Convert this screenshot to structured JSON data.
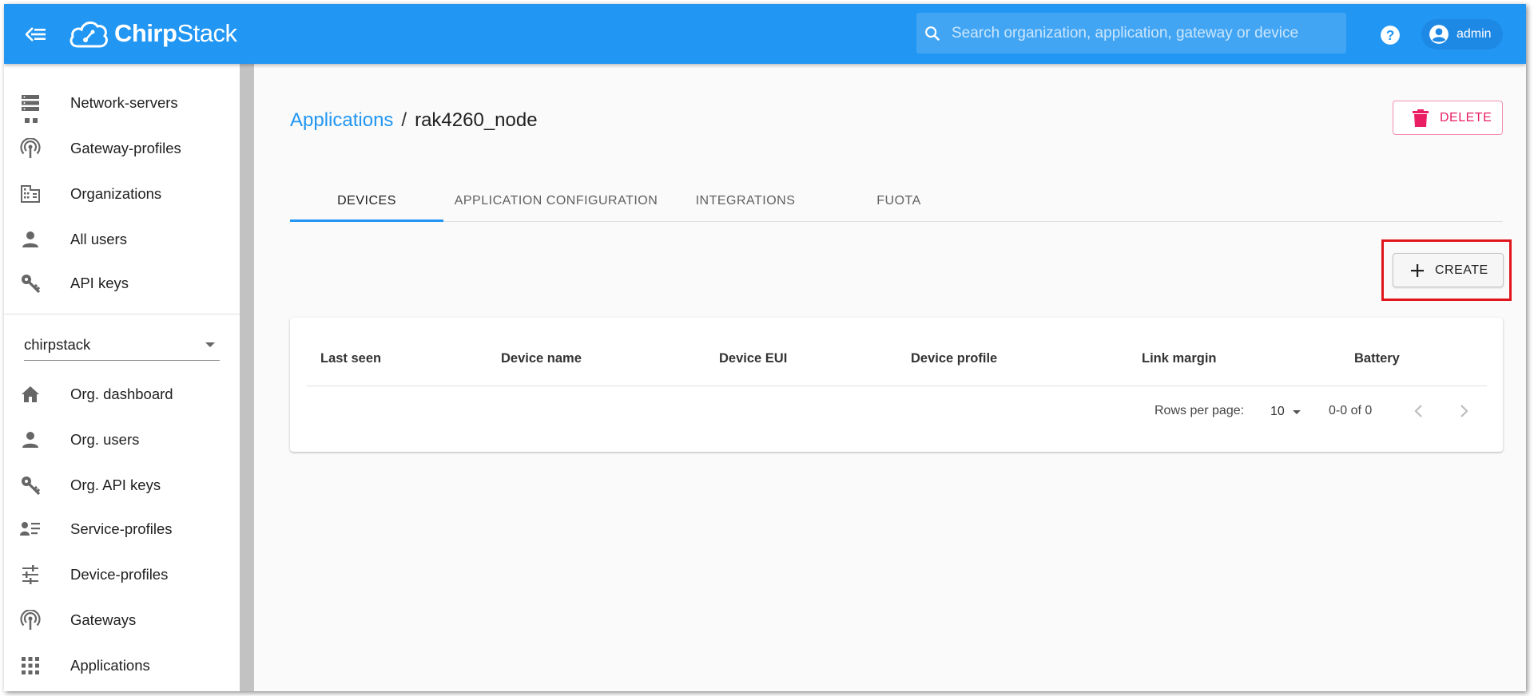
{
  "appbar": {
    "brand_prefix": "Chirp",
    "brand_suffix": "Stack",
    "search_placeholder": "Search organization, application, gateway or device",
    "user_name": "admin",
    "color": "#2196f3"
  },
  "sidebar": {
    "global_items": [
      {
        "label": "Network-servers",
        "icon": "network-server-icon"
      },
      {
        "label": "Gateway-profiles",
        "icon": "gateway-icon"
      },
      {
        "label": "Organizations",
        "icon": "organization-icon"
      },
      {
        "label": "All users",
        "icon": "user-icon"
      },
      {
        "label": "API keys",
        "icon": "key-icon"
      }
    ],
    "org_selected": "chirpstack",
    "org_items": [
      {
        "label": "Org. dashboard",
        "icon": "home-icon"
      },
      {
        "label": "Org. users",
        "icon": "user-icon"
      },
      {
        "label": "Org. API keys",
        "icon": "key-icon"
      },
      {
        "label": "Service-profiles",
        "icon": "service-profile-icon"
      },
      {
        "label": "Device-profiles",
        "icon": "tune-icon"
      },
      {
        "label": "Gateways",
        "icon": "gateway-icon"
      },
      {
        "label": "Applications",
        "icon": "apps-grid-icon"
      }
    ]
  },
  "page": {
    "breadcrumb_link": "Applications",
    "breadcrumb_sep": "/",
    "title": "rak4260_node",
    "delete_label": "DELETE",
    "tabs": [
      "DEVICES",
      "APPLICATION CONFIGURATION",
      "INTEGRATIONS",
      "FUOTA"
    ],
    "active_tab": "DEVICES",
    "create_label": "CREATE"
  },
  "table": {
    "columns": [
      "Last seen",
      "Device name",
      "Device EUI",
      "Device profile",
      "Link margin",
      "Battery"
    ],
    "rows": [],
    "rows_per_page_label": "Rows per page:",
    "rows_per_page": "10",
    "range": "0-0 of 0"
  },
  "colors": {
    "accent": "#2196f3",
    "danger": "#e91e63",
    "highlight": "#e0161c"
  }
}
